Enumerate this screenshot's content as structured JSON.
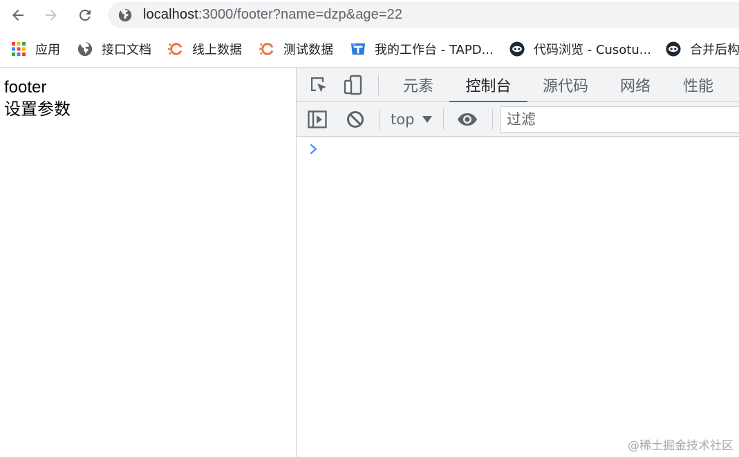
{
  "browser": {
    "url_host": "localhost",
    "url_path": ":3000/footer?name=dzp&age=22",
    "bookmarks": [
      {
        "label": "应用",
        "icon": "apps-grid-icon"
      },
      {
        "label": "接口文档",
        "icon": "globe-icon"
      },
      {
        "label": "线上数据",
        "icon": "c-logo-icon"
      },
      {
        "label": "测试数据",
        "icon": "c-logo-icon"
      },
      {
        "label": "我的工作台 - TAPD...",
        "icon": "tapd-icon"
      },
      {
        "label": "代码浏览 - Cusotu...",
        "icon": "code-eye-icon"
      },
      {
        "label": "合并后构",
        "icon": "code-eye-icon"
      }
    ]
  },
  "page": {
    "line1": "footer",
    "line2": "设置参数"
  },
  "devtools": {
    "tabs": [
      {
        "label": "元素",
        "active": false
      },
      {
        "label": "控制台",
        "active": true
      },
      {
        "label": "源代码",
        "active": false
      },
      {
        "label": "网络",
        "active": false
      },
      {
        "label": "性能",
        "active": false
      }
    ],
    "context": "top",
    "filter_placeholder": "过滤"
  },
  "watermark": "@稀土掘金技术社区",
  "colors": {
    "accent": "#1a73e8",
    "toolbar_bg": "#f1f3f4",
    "prompt": "#4d90fe",
    "bookmark_orange": "#e8733a"
  }
}
